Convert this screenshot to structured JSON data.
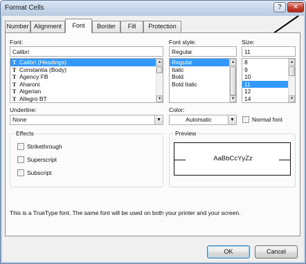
{
  "window": {
    "title": "Format Cells",
    "help_glyph": "?",
    "close_glyph": "✕"
  },
  "tabs": [
    {
      "label": "Number"
    },
    {
      "label": "Alignment"
    },
    {
      "label": "Font"
    },
    {
      "label": "Border"
    },
    {
      "label": "Fill"
    },
    {
      "label": "Protection"
    }
  ],
  "font": {
    "label": "Font:",
    "value": "Calibri",
    "items": [
      "Calibri (Headings)",
      "Constantia (Body)",
      "Agency FB",
      "Aharoni",
      "Algerian",
      "Allegro BT"
    ]
  },
  "font_style": {
    "label": "Font style:",
    "value": "Regular",
    "items": [
      "Regular",
      "Italic",
      "Bold",
      "Bold Italic"
    ]
  },
  "size": {
    "label": "Size:",
    "value": "11",
    "items": [
      "8",
      "9",
      "10",
      "11",
      "12",
      "14"
    ]
  },
  "underline": {
    "label": "Underline:",
    "value": "None"
  },
  "color": {
    "label": "Color:",
    "value": "Automatic"
  },
  "normal_font": {
    "label": "Normal font"
  },
  "effects": {
    "label": "Effects",
    "strikethrough": "Strikethrough",
    "superscript": "Superscript",
    "subscript": "Subscript"
  },
  "preview": {
    "label": "Preview",
    "sample": "AaBbCcYyZz"
  },
  "info_text": "This is a TrueType font.  The same font will be used on both your printer and your screen.",
  "buttons": {
    "ok": "OK",
    "cancel": "Cancel"
  },
  "colors": {
    "selection": "#3399ff",
    "dialog_bg": "#f0f0f0",
    "close_red": "#c4402f"
  }
}
